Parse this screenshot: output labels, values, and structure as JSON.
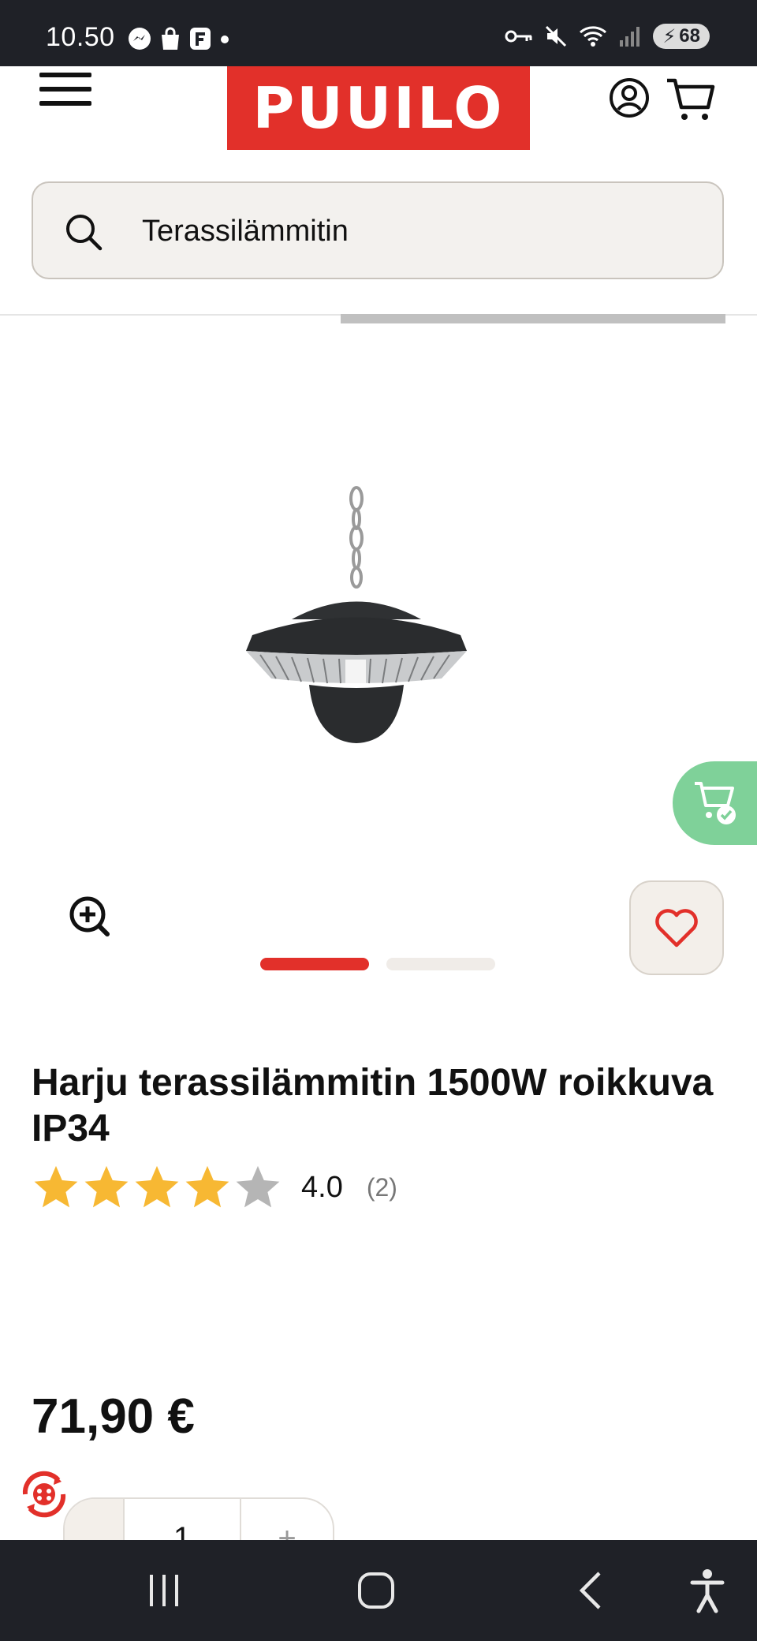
{
  "status_bar": {
    "time": "10.50",
    "battery": "68"
  },
  "header": {
    "logo_text": "PUUILO"
  },
  "search": {
    "value": "Terassilämmitin"
  },
  "product": {
    "title": "Harju terassilämmitin 1500W roikkuva IP34",
    "rating_value": "4.0",
    "rating_count": "(2)",
    "rating_stars": 4,
    "rating_max": 5,
    "price": "71,90 €",
    "quantity": "1"
  },
  "carousel": {
    "total": 2,
    "active": 0
  },
  "colors": {
    "brand": "#e2302a",
    "star": "#f7b833",
    "star_empty": "#b5b5b5",
    "fab": "#7fd199"
  }
}
